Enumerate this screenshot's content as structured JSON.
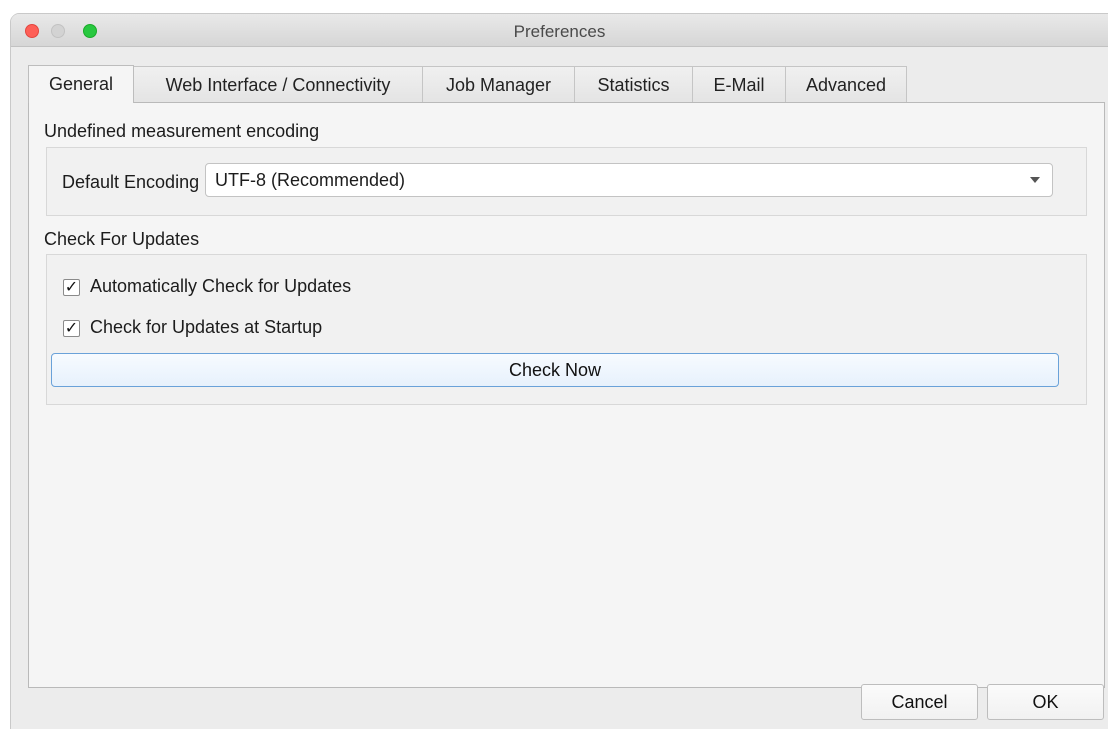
{
  "window": {
    "title": "Preferences"
  },
  "tabs": [
    {
      "label": "General",
      "active": true
    },
    {
      "label": "Web Interface / Connectivity",
      "active": false
    },
    {
      "label": "Job Manager",
      "active": false
    },
    {
      "label": "Statistics",
      "active": false
    },
    {
      "label": "E-Mail",
      "active": false
    },
    {
      "label": "Advanced",
      "active": false
    }
  ],
  "encoding": {
    "section_title": "Undefined measurement encoding",
    "label": "Default Encoding",
    "selected": "UTF-8 (Recommended)"
  },
  "updates": {
    "section_title": "Check For Updates",
    "auto_check": {
      "label": "Automatically Check for Updates",
      "checked": true,
      "mark": "✓"
    },
    "startup_check": {
      "label": "Check for Updates at Startup",
      "checked": true,
      "mark": "✓"
    },
    "check_now_label": "Check Now"
  },
  "footer": {
    "cancel_label": "Cancel",
    "ok_label": "OK"
  },
  "colors": {
    "accent": "#6aa2d9",
    "close": "#fe5f57",
    "maximize": "#28c840"
  }
}
